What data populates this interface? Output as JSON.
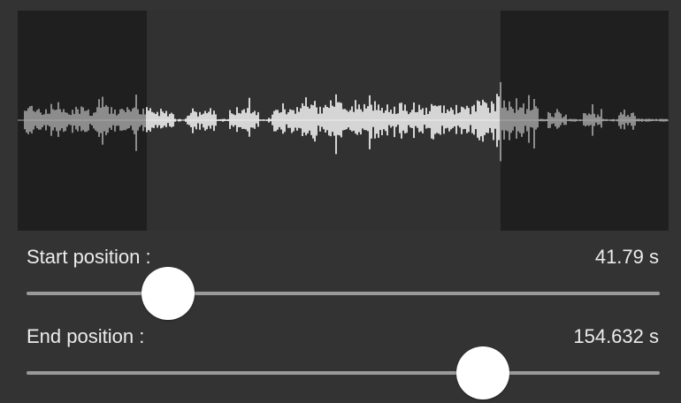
{
  "colors": {
    "background": "#333333",
    "waveform_panel": "#313131",
    "trimmed_region": "#1f1f1f",
    "waveform_selected": "#ffffff",
    "waveform_trimmed": "#a8a8a8",
    "slider_track": "#9a9a9a",
    "slider_thumb": "#ffffff",
    "text": "#ececec"
  },
  "start": {
    "label": "Start position :",
    "value": "41.79 s",
    "slider_fraction": 0.224
  },
  "end": {
    "label": "End position :",
    "value": "154.632 s",
    "slider_fraction": 0.72
  }
}
